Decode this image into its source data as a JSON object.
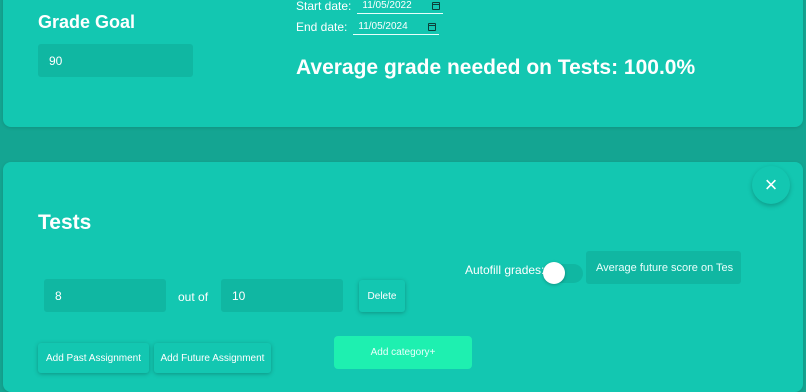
{
  "grade_goal": {
    "title": "Grade Goal",
    "value": "90"
  },
  "dates": {
    "start_label": "Start date:",
    "start_value": "11/05/2022",
    "end_label": "End date:",
    "end_value": "11/05/2024"
  },
  "summary": {
    "average_needed": "Average grade needed on Tests: 100.0%"
  },
  "category": {
    "close_icon": "×",
    "title": "Tests",
    "score_value": "8",
    "out_of_label": "out of",
    "total_value": "10",
    "delete_label": "Delete",
    "autofill_label": "Autofill grades:",
    "autofill_enabled": false,
    "avg_future_placeholder": "Average future score on Tes",
    "add_past_label": "Add Past Assignment",
    "add_future_label": "Add Future Assignment",
    "add_category_label": "Add category+"
  },
  "colors": {
    "page_background": "#14a592",
    "card_background": "#13c7b1",
    "field_background": "#10b7a2",
    "accent_button": "#1ef0b0"
  }
}
